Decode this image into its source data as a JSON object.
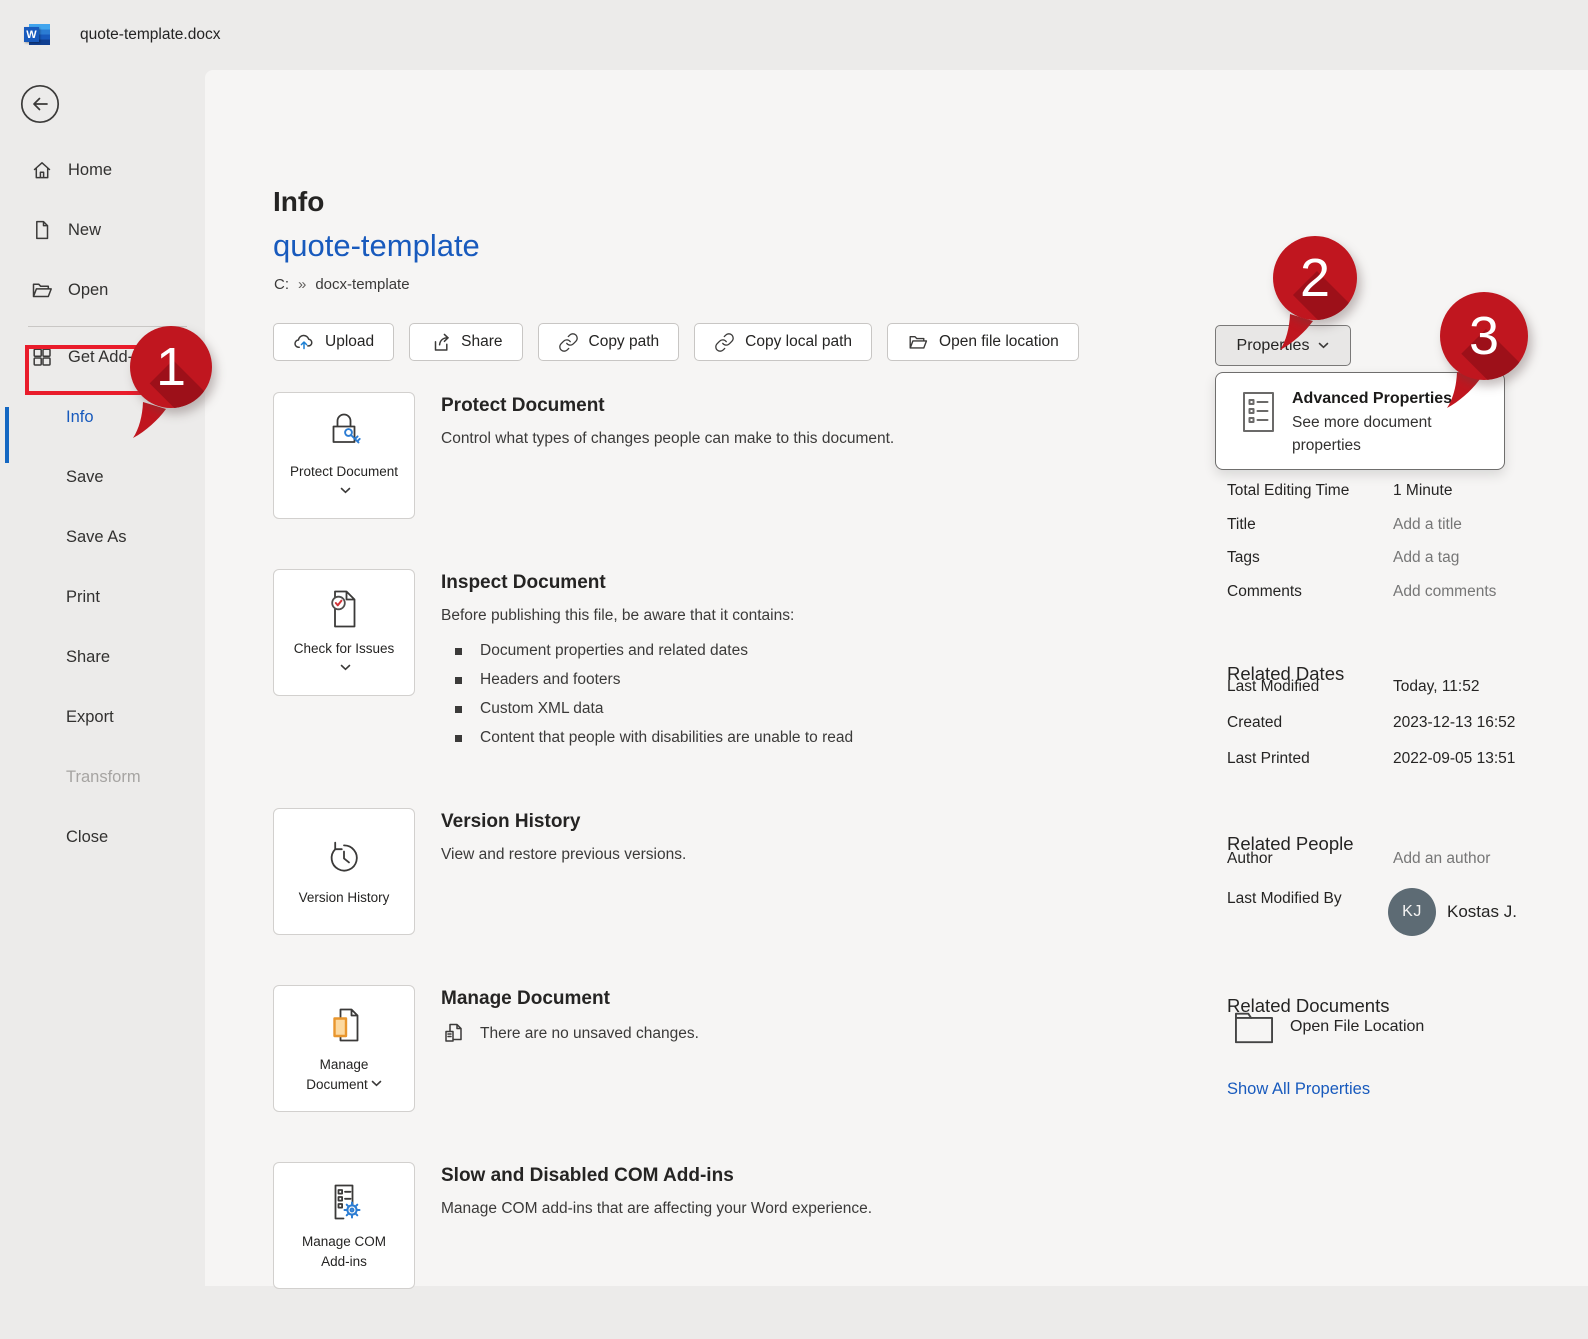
{
  "colors": {
    "accent_blue": "#185abd",
    "link_blue": "#185abd",
    "callout_red": "#c0161f",
    "callout_shadow_red": "#9d1019",
    "highlight_box_red": "#e91c2b",
    "avatar_bg": "#5d6b74",
    "manage_doc_orange": "#e8962e",
    "key_blue": "#2b7cd3",
    "chrome_bg": "#ecebea",
    "panel_bg": "#f6f5f4"
  },
  "titlebar": {
    "app_icon": "word-logo-icon",
    "app_icon_letter": "W",
    "filename": "quote-template.docx"
  },
  "sidebar": {
    "back_icon": "back-arrow-icon",
    "items": [
      {
        "label": "Home",
        "icon": "home-icon"
      },
      {
        "label": "New",
        "icon": "new-document-icon"
      },
      {
        "label": "Open",
        "icon": "open-folder-icon"
      },
      {
        "label": "Get Add-ins",
        "icon": "add-ins-grid-icon"
      },
      {
        "label": "Info",
        "active": true
      },
      {
        "label": "Save"
      },
      {
        "label": "Save As"
      },
      {
        "label": "Print"
      },
      {
        "label": "Share"
      },
      {
        "label": "Export"
      },
      {
        "label": "Transform",
        "disabled": true
      },
      {
        "label": "Close"
      }
    ]
  },
  "header": {
    "page_title": "Info",
    "document_title": "quote-template",
    "breadcrumb": {
      "drive": "C:",
      "separator": "»",
      "folder": "docx-template"
    }
  },
  "toolbar": {
    "buttons": [
      {
        "label": "Upload",
        "icon": "upload-cloud-icon"
      },
      {
        "label": "Share",
        "icon": "share-icon"
      },
      {
        "label": "Copy path",
        "icon": "link-icon"
      },
      {
        "label": "Copy local path",
        "icon": "link-icon"
      },
      {
        "label": "Open file location",
        "icon": "open-folder-icon"
      }
    ]
  },
  "sections": [
    {
      "card_label": "Protect Document",
      "icon": "lock-key-icon",
      "has_chevron": true,
      "title": "Protect Document",
      "description": "Control what types of changes people can make to this document."
    },
    {
      "card_label": "Check for Issues",
      "icon": "inspect-document-icon",
      "has_chevron": true,
      "title": "Inspect Document",
      "description": "Before publishing this file, be aware that it contains:",
      "bullets": [
        "Document properties and related dates",
        "Headers and footers",
        "Custom XML data",
        "Content that people with disabilities are unable to read"
      ]
    },
    {
      "card_label": "Version History",
      "icon": "version-history-icon",
      "has_chevron": false,
      "title": "Version History",
      "description": "View and restore previous versions."
    },
    {
      "card_label": "Manage Document",
      "icon": "manage-document-icon",
      "has_chevron": true,
      "title": "Manage Document",
      "status_icon": "unsaved-changes-doc-icon",
      "description": "There are no unsaved changes."
    },
    {
      "card_label": "Manage COM Add-ins",
      "icon": "com-add-ins-gear-icon",
      "has_chevron": false,
      "title": "Slow and Disabled COM Add-ins",
      "description": "Manage COM add-ins that are affecting your Word experience."
    }
  ],
  "properties_panel": {
    "properties_button": {
      "label": "Properties",
      "icon": "chevron-down-icon"
    },
    "dropdown": {
      "icon": "document-properties-list-icon",
      "title": "Advanced Properties",
      "subtitle": "See more document properties"
    },
    "rows": [
      {
        "label": "Total Editing Time",
        "value": "1 Minute",
        "placeholder": false
      },
      {
        "label": "Title",
        "value": "Add a title",
        "placeholder": true
      },
      {
        "label": "Tags",
        "value": "Add a tag",
        "placeholder": true
      },
      {
        "label": "Comments",
        "value": "Add comments",
        "placeholder": true
      }
    ],
    "related_dates": {
      "heading": "Related Dates",
      "rows": [
        {
          "label": "Last Modified",
          "value": "Today, 11:52"
        },
        {
          "label": "Created",
          "value": "2023-12-13 16:52"
        },
        {
          "label": "Last Printed",
          "value": "2022-09-05 13:51"
        }
      ]
    },
    "related_people": {
      "heading": "Related People",
      "author_label": "Author",
      "author_placeholder": "Add an author",
      "last_modified_by_label": "Last Modified By",
      "avatar_initials": "KJ",
      "person_name": "Kostas J."
    },
    "related_documents": {
      "heading": "Related Documents",
      "open_file_location_label": "Open File Location",
      "icon": "folder-icon"
    },
    "show_all_properties_label": "Show All Properties"
  },
  "annotations": {
    "callouts": [
      {
        "number": "1"
      },
      {
        "number": "2"
      },
      {
        "number": "3"
      }
    ]
  }
}
